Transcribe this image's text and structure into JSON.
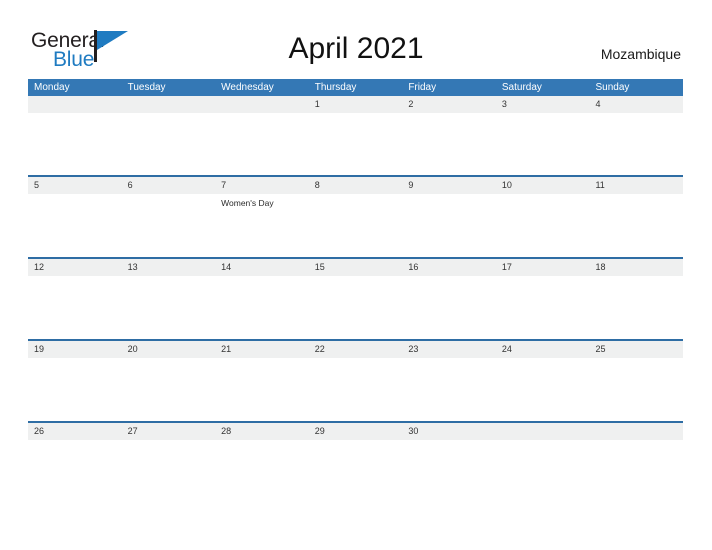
{
  "brand": {
    "name_part1": "General",
    "name_part2": "Blue",
    "logo_icon": "blue-flag-triangle-icon",
    "color_dark": "#231f20",
    "color_blue": "#1f7bc1"
  },
  "header": {
    "title": "April 2021",
    "country": "Mozambique"
  },
  "theme": {
    "header_blue": "#3478b5",
    "rule_blue": "#2e6da4",
    "date_band_gray": "#eff0f0",
    "text_dark": "#333333"
  },
  "calendar": {
    "weekdays": [
      {
        "label": "Monday"
      },
      {
        "label": "Tuesday"
      },
      {
        "label": "Wednesday"
      },
      {
        "label": "Thursday"
      },
      {
        "label": "Friday"
      },
      {
        "label": "Saturday"
      },
      {
        "label": "Sunday"
      }
    ],
    "weeks": [
      {
        "dates": [
          "",
          "",
          "",
          "1",
          "2",
          "3",
          "4"
        ],
        "events": [
          "",
          "",
          "",
          "",
          "",
          "",
          ""
        ]
      },
      {
        "dates": [
          "5",
          "6",
          "7",
          "8",
          "9",
          "10",
          "11"
        ],
        "events": [
          "",
          "",
          "Women's Day",
          "",
          "",
          "",
          ""
        ]
      },
      {
        "dates": [
          "12",
          "13",
          "14",
          "15",
          "16",
          "17",
          "18"
        ],
        "events": [
          "",
          "",
          "",
          "",
          "",
          "",
          ""
        ]
      },
      {
        "dates": [
          "19",
          "20",
          "21",
          "22",
          "23",
          "24",
          "25"
        ],
        "events": [
          "",
          "",
          "",
          "",
          "",
          "",
          ""
        ]
      },
      {
        "dates": [
          "26",
          "27",
          "28",
          "29",
          "30",
          "",
          ""
        ],
        "events": [
          "",
          "",
          "",
          "",
          "",
          "",
          ""
        ]
      }
    ]
  }
}
